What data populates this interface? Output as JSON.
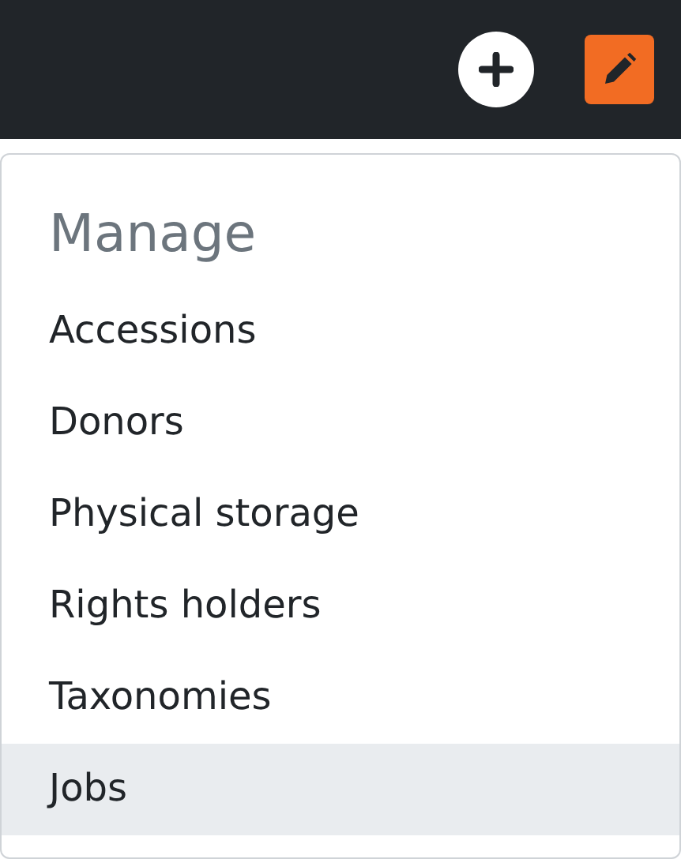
{
  "menu": {
    "heading": "Manage",
    "items": [
      {
        "label": "Accessions",
        "selected": false
      },
      {
        "label": "Donors",
        "selected": false
      },
      {
        "label": "Physical storage",
        "selected": false
      },
      {
        "label": "Rights holders",
        "selected": false
      },
      {
        "label": "Taxonomies",
        "selected": false
      },
      {
        "label": "Jobs",
        "selected": true
      }
    ]
  }
}
